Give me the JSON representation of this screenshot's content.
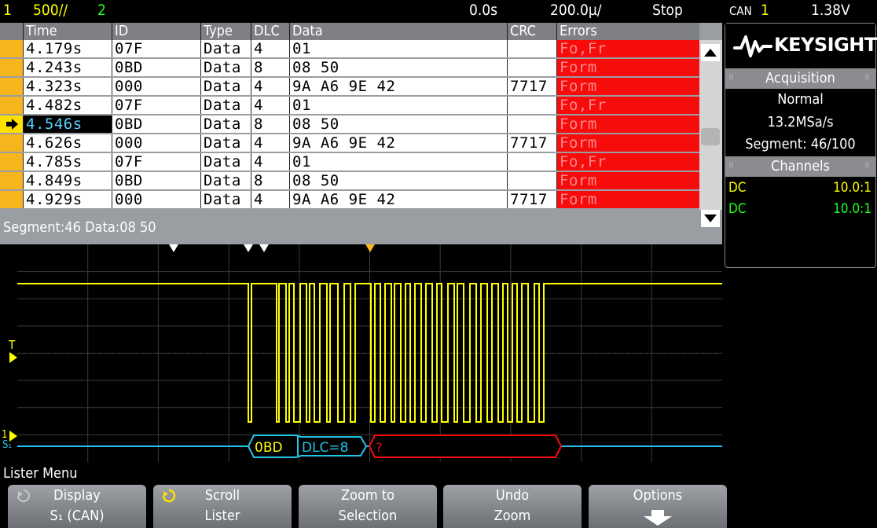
{
  "topbar": {
    "ch1_num": "1",
    "ch1_scale": "500∕/",
    "ch2_num": "2",
    "time_delay": "0.0s",
    "time_scale": "200.0µ/",
    "run_state": "Stop",
    "trigger_type": "CAN",
    "trigger_src": "1",
    "trigger_level": "1.38V"
  },
  "lister": {
    "headers": [
      "Time",
      "ID",
      "Type",
      "DLC",
      "Data",
      "CRC",
      "Errors"
    ],
    "rows": [
      {
        "time": "4.179s",
        "id": "07F",
        "type": "Data",
        "dlc": "4",
        "data": "01",
        "crc": "",
        "errors": "Fo,Fr"
      },
      {
        "time": "4.243s",
        "id": "0BD",
        "type": "Data",
        "dlc": "8",
        "data": "08 50",
        "crc": "",
        "errors": "Form"
      },
      {
        "time": "4.323s",
        "id": "000",
        "type": "Data",
        "dlc": "4",
        "data": "9A A6 9E 42",
        "crc": "7717",
        "errors": "Form"
      },
      {
        "time": "4.482s",
        "id": "07F",
        "type": "Data",
        "dlc": "4",
        "data": "01",
        "crc": "",
        "errors": "Fo,Fr"
      },
      {
        "time": "4.546s",
        "id": "0BD",
        "type": "Data",
        "dlc": "8",
        "data": "08 50",
        "crc": "",
        "errors": "Form"
      },
      {
        "time": "4.626s",
        "id": "000",
        "type": "Data",
        "dlc": "4",
        "data": "9A A6 9E 42",
        "crc": "7717",
        "errors": "Form"
      },
      {
        "time": "4.785s",
        "id": "07F",
        "type": "Data",
        "dlc": "4",
        "data": "01",
        "crc": "",
        "errors": "Fo,Fr"
      },
      {
        "time": "4.849s",
        "id": "0BD",
        "type": "Data",
        "dlc": "8",
        "data": "08 50",
        "crc": "",
        "errors": "Form"
      },
      {
        "time": "4.929s",
        "id": "000",
        "type": "Data",
        "dlc": "4",
        "data": "9A A6 9E 42",
        "crc": "7717",
        "errors": "Form"
      }
    ],
    "selected_index": 4,
    "status": "Segment:46 Data:08  50"
  },
  "panel": {
    "brand": "KEYSIGHT",
    "acq_title": "Acquisition",
    "acq_mode": "Normal",
    "acq_rate": "13.2MSa/s",
    "acq_segment": "Segment: 46/100",
    "ch_title": "Channels",
    "ch1_coupling": "DC",
    "ch1_probe": "10.0:1",
    "ch2_coupling": "DC",
    "ch2_probe": "10.0:1"
  },
  "decode": {
    "id_label": "0BD",
    "dlc_label": "DLC=8",
    "err_label": "?"
  },
  "waveform": {
    "trigger_marker": "T",
    "ch_label": "S₁"
  },
  "menu": {
    "title": "Lister Menu",
    "softkeys": [
      {
        "line1": "Display",
        "line2": "S₁ (CAN)"
      },
      {
        "line1": "Scroll",
        "line2": "Lister"
      },
      {
        "line1": "Zoom to",
        "line2": "Selection"
      },
      {
        "line1": "Undo",
        "line2": "Zoom"
      },
      {
        "line1": "Options",
        "line2": ""
      }
    ]
  },
  "colors": {
    "ch1": "#ffff00",
    "ch2": "#22ff22",
    "decode": "#22c4e6",
    "error": "#f70c0c"
  }
}
